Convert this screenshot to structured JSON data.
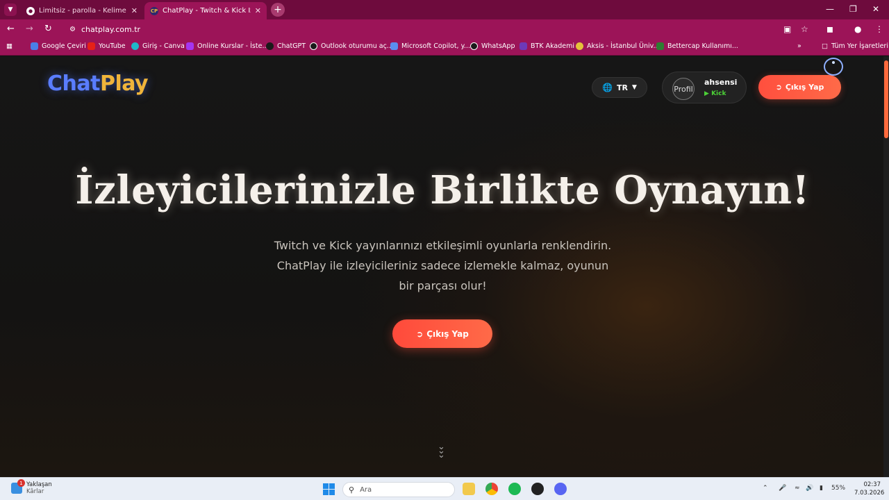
{
  "browser": {
    "tabs": [
      {
        "title": "Limitsiz - parolla - Kelime oyunu",
        "favicon": "globe-icon",
        "active": false
      },
      {
        "title": "ChatPlay - Twitch & Kick İzleyici",
        "favicon": "CP",
        "active": true
      }
    ],
    "new_tab": "+",
    "address": "chatplay.com.tr",
    "bookmarks": [
      {
        "label": "Google Çeviri",
        "color": "#4a7ee8"
      },
      {
        "label": "YouTube",
        "color": "#e62117"
      },
      {
        "label": "Giriş - Canva",
        "color": "#1fb8c9"
      },
      {
        "label": "Online Kurslar - İste...",
        "color": "#a435f0"
      },
      {
        "label": "ChatGPT",
        "color": "#1a1a1a"
      },
      {
        "label": "Outlook oturumu aç...",
        "color": "#1a1a1a"
      },
      {
        "label": "Microsoft Copilot, y...",
        "color": "#5b8def"
      },
      {
        "label": "WhatsApp",
        "color": "#1a1a1a"
      },
      {
        "label": "BTK Akademi",
        "color": "#6d3ab8"
      },
      {
        "label": "Aksis - İstanbul Üniv...",
        "color": "#e4c23a"
      },
      {
        "label": "Bettercap Kullanımı...",
        "color": "#2e7d32"
      }
    ],
    "all_bookmarks": "Tüm Yer İşaretleri"
  },
  "site": {
    "logo_chat": "Chat",
    "logo_play": "Play",
    "language": "TR",
    "user": {
      "avatar_alt": "Profil",
      "name": "ahsensi",
      "platform": "Kick"
    },
    "logout_label": "Çıkış Yap",
    "hero": {
      "title": "İzleyicilerinizle Birlikte Oynayın!",
      "subtitle_line1": "Twitch ve Kick yayınlarınızı etkileşimli oyunlarla renklendirin.",
      "subtitle_line2": "ChatPlay ile izleyicileriniz sadece izlemekle kalmaz, oyunun",
      "subtitle_line3": "bir parçası olur!",
      "cta_label": "Çıkış Yap"
    },
    "colors": {
      "accent": "#ff5a44",
      "logo_blue": "#5a7dff",
      "logo_gold": "#f0b43a"
    }
  },
  "taskbar": {
    "weather_title": "Yaklaşan",
    "weather_sub": "Kârlar",
    "weather_badge": "1",
    "search_placeholder": "Ara",
    "battery": "55%",
    "time": "02:37",
    "date": "7.03.2026"
  }
}
